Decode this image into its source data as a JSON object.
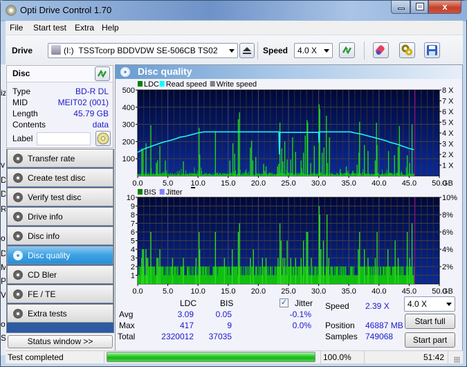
{
  "window": {
    "title": "Opti Drive Control 1.70",
    "controls": {
      "minimize": "minimize",
      "maximize": "maximize",
      "close": "x"
    }
  },
  "menu": [
    "File",
    "Start test",
    "Extra",
    "Help"
  ],
  "toolbar": {
    "drive_label": "Drive",
    "drive_letter": "(I:)",
    "drive_value": "TSSTcorp BDDVDW SE-506CB TS02",
    "speed_label": "Speed",
    "speed_value": "4.0 X"
  },
  "disc": {
    "header": "Disc",
    "fields": [
      {
        "label": "Type",
        "value": "BD-R DL"
      },
      {
        "label": "MID",
        "value": "MEIT02 (001)"
      },
      {
        "label": "Length",
        "value": "45.79 GB"
      },
      {
        "label": "Contents",
        "value": "data"
      }
    ],
    "label_label": "Label",
    "label_value": ""
  },
  "nav": [
    {
      "label": "Transfer rate",
      "active": false
    },
    {
      "label": "Create test disc",
      "active": false
    },
    {
      "label": "Verify test disc",
      "active": false
    },
    {
      "label": "Drive info",
      "active": false
    },
    {
      "label": "Disc info",
      "active": false
    },
    {
      "label": "Disc quality",
      "active": true
    },
    {
      "label": "CD Bler",
      "active": false
    },
    {
      "label": "FE / TE",
      "active": false
    },
    {
      "label": "Extra tests",
      "active": false
    }
  ],
  "status_window_button": "Status window >>",
  "main": {
    "title": "Disc quality"
  },
  "chart_data": [
    {
      "type": "bar",
      "title": "LDC",
      "legend": [
        "LDC",
        "Read speed",
        "Write speed"
      ],
      "legend_colors": {
        "LDC": "#008000",
        "Read speed": "#00ffff",
        "Write speed": "#808080"
      },
      "xlabel": "GB",
      "xlim": [
        0,
        50
      ],
      "x_ticks": [
        "0.0",
        "5.0",
        "10.0",
        "15.0",
        "20.0",
        "25.0",
        "30.0",
        "35.0",
        "40.0",
        "45.0",
        "50.0"
      ],
      "ylim": [
        0,
        500
      ],
      "y_ticks": [
        "100",
        "200",
        "300",
        "400",
        "500"
      ],
      "y2_ticks": [
        "1 X",
        "2 X",
        "3 X",
        "4 X",
        "5 X",
        "6 X",
        "7 X",
        "8 X"
      ],
      "y2lim": [
        0,
        8
      ],
      "end_marker_gb": 45.79,
      "grid": true,
      "ldc_spikes": [
        [
          0.6,
          160
        ],
        [
          0.8,
          150
        ],
        [
          1.3,
          190
        ],
        [
          2.1,
          295
        ],
        [
          3.0,
          75
        ],
        [
          3.2,
          90
        ],
        [
          3.6,
          175
        ],
        [
          4.5,
          90
        ],
        [
          7.5,
          85
        ],
        [
          10.1,
          280
        ],
        [
          10.2,
          125
        ],
        [
          12.8,
          260
        ],
        [
          15.2,
          90
        ],
        [
          15.7,
          190
        ],
        [
          16.0,
          130
        ],
        [
          16.6,
          330
        ],
        [
          16.8,
          370
        ],
        [
          18.6,
          165
        ],
        [
          18.8,
          205
        ],
        [
          19.0,
          90
        ],
        [
          19.5,
          110
        ],
        [
          20.8,
          70
        ],
        [
          21.2,
          55
        ],
        [
          23.1,
          55
        ],
        [
          23.3,
          70
        ],
        [
          23.5,
          310
        ],
        [
          23.8,
          160
        ],
        [
          24.0,
          85
        ],
        [
          24.3,
          200
        ],
        [
          24.7,
          95
        ],
        [
          25.3,
          95
        ],
        [
          25.6,
          225
        ],
        [
          26.1,
          140
        ],
        [
          27.0,
          90
        ],
        [
          27.4,
          135
        ],
        [
          27.7,
          235
        ],
        [
          28.0,
          325
        ],
        [
          28.1,
          310
        ],
        [
          28.6,
          75
        ],
        [
          29.2,
          175
        ],
        [
          30.0,
          417
        ],
        [
          30.1,
          390
        ],
        [
          30.5,
          135
        ],
        [
          30.8,
          165
        ],
        [
          31.2,
          350
        ],
        [
          31.4,
          75
        ],
        [
          31.7,
          225
        ],
        [
          33.5,
          40
        ],
        [
          34.5,
          55
        ],
        [
          35.6,
          30
        ],
        [
          36.3,
          65
        ],
        [
          36.6,
          135
        ],
        [
          36.7,
          315
        ],
        [
          37.5,
          180
        ],
        [
          38.1,
          145
        ],
        [
          39.3,
          90
        ],
        [
          39.5,
          310
        ],
        [
          39.6,
          180
        ],
        [
          41.5,
          145
        ],
        [
          42.5,
          120
        ],
        [
          43.1,
          170
        ],
        [
          43.3,
          290
        ],
        [
          44.6,
          120
        ],
        [
          45.0,
          75
        ],
        [
          45.4,
          300
        ]
      ],
      "ldc_baseline": 12,
      "read_speed": [
        [
          0,
          2.2
        ],
        [
          1,
          2.5
        ],
        [
          2,
          2.7
        ],
        [
          3,
          2.9
        ],
        [
          4,
          3.1
        ],
        [
          5,
          3.25
        ],
        [
          6,
          3.4
        ],
        [
          7,
          3.6
        ],
        [
          8,
          3.7
        ],
        [
          9,
          3.85
        ],
        [
          10,
          4.0
        ],
        [
          11,
          4.1
        ],
        [
          11.3,
          4.1
        ],
        [
          23.4,
          4.1
        ],
        [
          23.5,
          2.0
        ],
        [
          23.6,
          4.05
        ],
        [
          30.0,
          4.05
        ],
        [
          30.05,
          3.1
        ],
        [
          30.1,
          4.1
        ],
        [
          35.3,
          4.1
        ],
        [
          36,
          4.0
        ],
        [
          37,
          3.9
        ],
        [
          38,
          3.75
        ],
        [
          39,
          3.6
        ],
        [
          40,
          3.45
        ],
        [
          41,
          3.3
        ],
        [
          42,
          3.1
        ],
        [
          43,
          2.95
        ],
        [
          44,
          2.75
        ],
        [
          45,
          2.55
        ],
        [
          45.79,
          2.45
        ]
      ]
    },
    {
      "type": "bar",
      "title": "BIS",
      "legend": [
        "BIS",
        "Jitter"
      ],
      "legend_colors": {
        "BIS": "#008000",
        "Jitter": "#8080ff"
      },
      "xlabel": "GB",
      "xlim": [
        0,
        50
      ],
      "x_ticks": [
        "0.0",
        "5.0",
        "10.0",
        "15.0",
        "20.0",
        "25.0",
        "30.0",
        "35.0",
        "40.0",
        "45.0",
        "50.0"
      ],
      "ylim": [
        0,
        10
      ],
      "y_ticks": [
        "1",
        "2",
        "3",
        "4",
        "5",
        "6",
        "7",
        "8",
        "9",
        "10"
      ],
      "y2_ticks": [
        "2%",
        "4%",
        "6%",
        "8%",
        "10%"
      ],
      "y2lim": [
        0,
        10
      ],
      "end_marker_gb": 45.79,
      "grid": true,
      "bis_spikes": [
        [
          0.6,
          3
        ],
        [
          0.7,
          4
        ],
        [
          0.9,
          4
        ],
        [
          1.3,
          4
        ],
        [
          1.4,
          3
        ],
        [
          1.6,
          3
        ],
        [
          2.1,
          6
        ],
        [
          3.1,
          3
        ],
        [
          3.3,
          3
        ],
        [
          3.6,
          4
        ],
        [
          5.7,
          3
        ],
        [
          7.5,
          3
        ],
        [
          9.6,
          3
        ],
        [
          10.1,
          6
        ],
        [
          10.2,
          4
        ],
        [
          12.8,
          6
        ],
        [
          14.3,
          3
        ],
        [
          15.6,
          4
        ],
        [
          16.6,
          6
        ],
        [
          16.8,
          7
        ],
        [
          18.6,
          3
        ],
        [
          19.1,
          4
        ],
        [
          20.6,
          3
        ],
        [
          21.2,
          3
        ],
        [
          23.2,
          3
        ],
        [
          23.5,
          7
        ],
        [
          23.7,
          5
        ],
        [
          24.0,
          3
        ],
        [
          24.3,
          3
        ],
        [
          24.7,
          5
        ],
        [
          25.3,
          3
        ],
        [
          26.1,
          3
        ],
        [
          27.0,
          3
        ],
        [
          27.4,
          5
        ],
        [
          27.9,
          6
        ],
        [
          28.1,
          6
        ],
        [
          28.7,
          3
        ],
        [
          30.0,
          9
        ],
        [
          30.1,
          8
        ],
        [
          30.3,
          4
        ],
        [
          30.7,
          5
        ],
        [
          31.3,
          8
        ],
        [
          31.6,
          3
        ],
        [
          36.5,
          4
        ],
        [
          36.7,
          6
        ],
        [
          37.5,
          4
        ],
        [
          38.1,
          3
        ],
        [
          39.3,
          3
        ],
        [
          39.6,
          6
        ],
        [
          41.4,
          4
        ],
        [
          42.6,
          5
        ],
        [
          43.1,
          3
        ],
        [
          44.6,
          6
        ],
        [
          45.0,
          3
        ],
        [
          45.4,
          7
        ]
      ],
      "bis_baseline_pattern": "mostly 1-2"
    }
  ],
  "stats": {
    "col_ldc": "LDC",
    "col_bis": "BIS",
    "jitter_label": "Jitter",
    "jitter_checked": true,
    "rows": [
      {
        "label": "Avg",
        "ldc": "3.09",
        "bis": "0.05",
        "jitter": "-0.1%"
      },
      {
        "label": "Max",
        "ldc": "417",
        "bis": "9",
        "jitter": "0.0%"
      },
      {
        "label": "Total",
        "ldc": "2320012",
        "bis": "37035",
        "jitter": ""
      }
    ],
    "speed_label": "Speed",
    "speed_value": "2.39 X",
    "position_label": "Position",
    "position_value": "46887 MB",
    "samples_label": "Samples",
    "samples_value": "749068",
    "speed_select": "4.0 X",
    "start_full": "Start full",
    "start_part": "Start part"
  },
  "statusbar": {
    "status_text": "Test completed",
    "progress_percent": 100.0,
    "progress_text": "100.0%",
    "time": "51:42"
  },
  "background_window_fragments": [
    "iz",
    "v",
    "D",
    "D",
    "R",
    "or",
    "D",
    "M",
    "Pi",
    "Vi",
    "or",
    "S",
    "e"
  ]
}
